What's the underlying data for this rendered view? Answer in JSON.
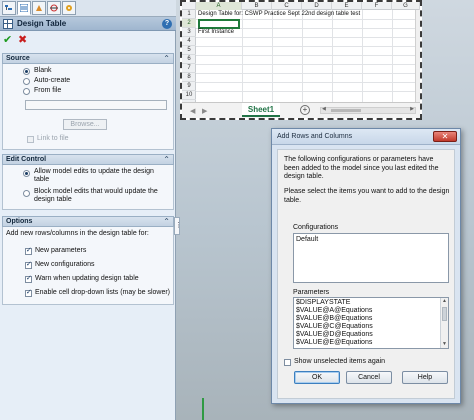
{
  "property_manager": {
    "tabs": [
      {
        "icon": "feature-manager-icon"
      },
      {
        "icon": "property-manager-icon"
      },
      {
        "icon": "configuration-manager-icon"
      },
      {
        "icon": "dimxpert-icon"
      },
      {
        "icon": "display-manager-icon"
      }
    ],
    "title": "Design Table",
    "help_icon": "?",
    "ok_icon": "✔",
    "cancel_icon": "✖",
    "source": {
      "header": "Source",
      "options": [
        {
          "label": "Blank",
          "selected": true
        },
        {
          "label": "Auto-create",
          "selected": false
        },
        {
          "label": "From file",
          "selected": false
        }
      ],
      "file_value": "",
      "browse_label": "Browse...",
      "link_to_file_label": "Link to file"
    },
    "edit_control": {
      "header": "Edit Control",
      "options": [
        {
          "label": "Allow model edits to update the design table",
          "selected": true
        },
        {
          "label": "Block model edits that would update the design table",
          "selected": false
        }
      ]
    },
    "options": {
      "header": "Options",
      "intro": "Add new rows/columns in the design table for:",
      "items": [
        {
          "label": "New parameters",
          "checked": true
        },
        {
          "label": "New configurations",
          "checked": true
        },
        {
          "label": "Warn when updating design table",
          "checked": true
        },
        {
          "label": "Enable cell drop-down lists (may be slower)",
          "checked": true
        }
      ]
    },
    "chevron": "⌃"
  },
  "spreadsheet": {
    "columns": [
      "A",
      "B",
      "C",
      "D",
      "E",
      "F",
      "G"
    ],
    "rows": [
      "1",
      "2",
      "3",
      "4",
      "5",
      "6",
      "7",
      "8",
      "9",
      "10"
    ],
    "cells": {
      "A1": "Design Table for: CSWP Practice Sept 22nd design table test",
      "A3": "First Instance"
    },
    "sheet_tab": "Sheet1",
    "add_sheet": "+"
  },
  "dialog": {
    "title": "Add Rows and Columns",
    "close": "✕",
    "description": "The following configurations or parameters have been added to the model since you last edited the design table.",
    "instruction": "Please select the items you want to add to the design table.",
    "configurations_label": "Configurations",
    "configurations": [
      "Default"
    ],
    "parameters_label": "Parameters",
    "parameters": [
      "$DISPLAYSTATE",
      "$VALUE@A@Equations",
      "$VALUE@B@Equations",
      "$VALUE@C@Equations",
      "$VALUE@D@Equations",
      "$VALUE@E@Equations"
    ],
    "show_unselected_label": "Show unselected items again",
    "show_unselected_checked": false,
    "buttons": {
      "ok": "OK",
      "cancel": "Cancel",
      "help": "Help"
    }
  }
}
